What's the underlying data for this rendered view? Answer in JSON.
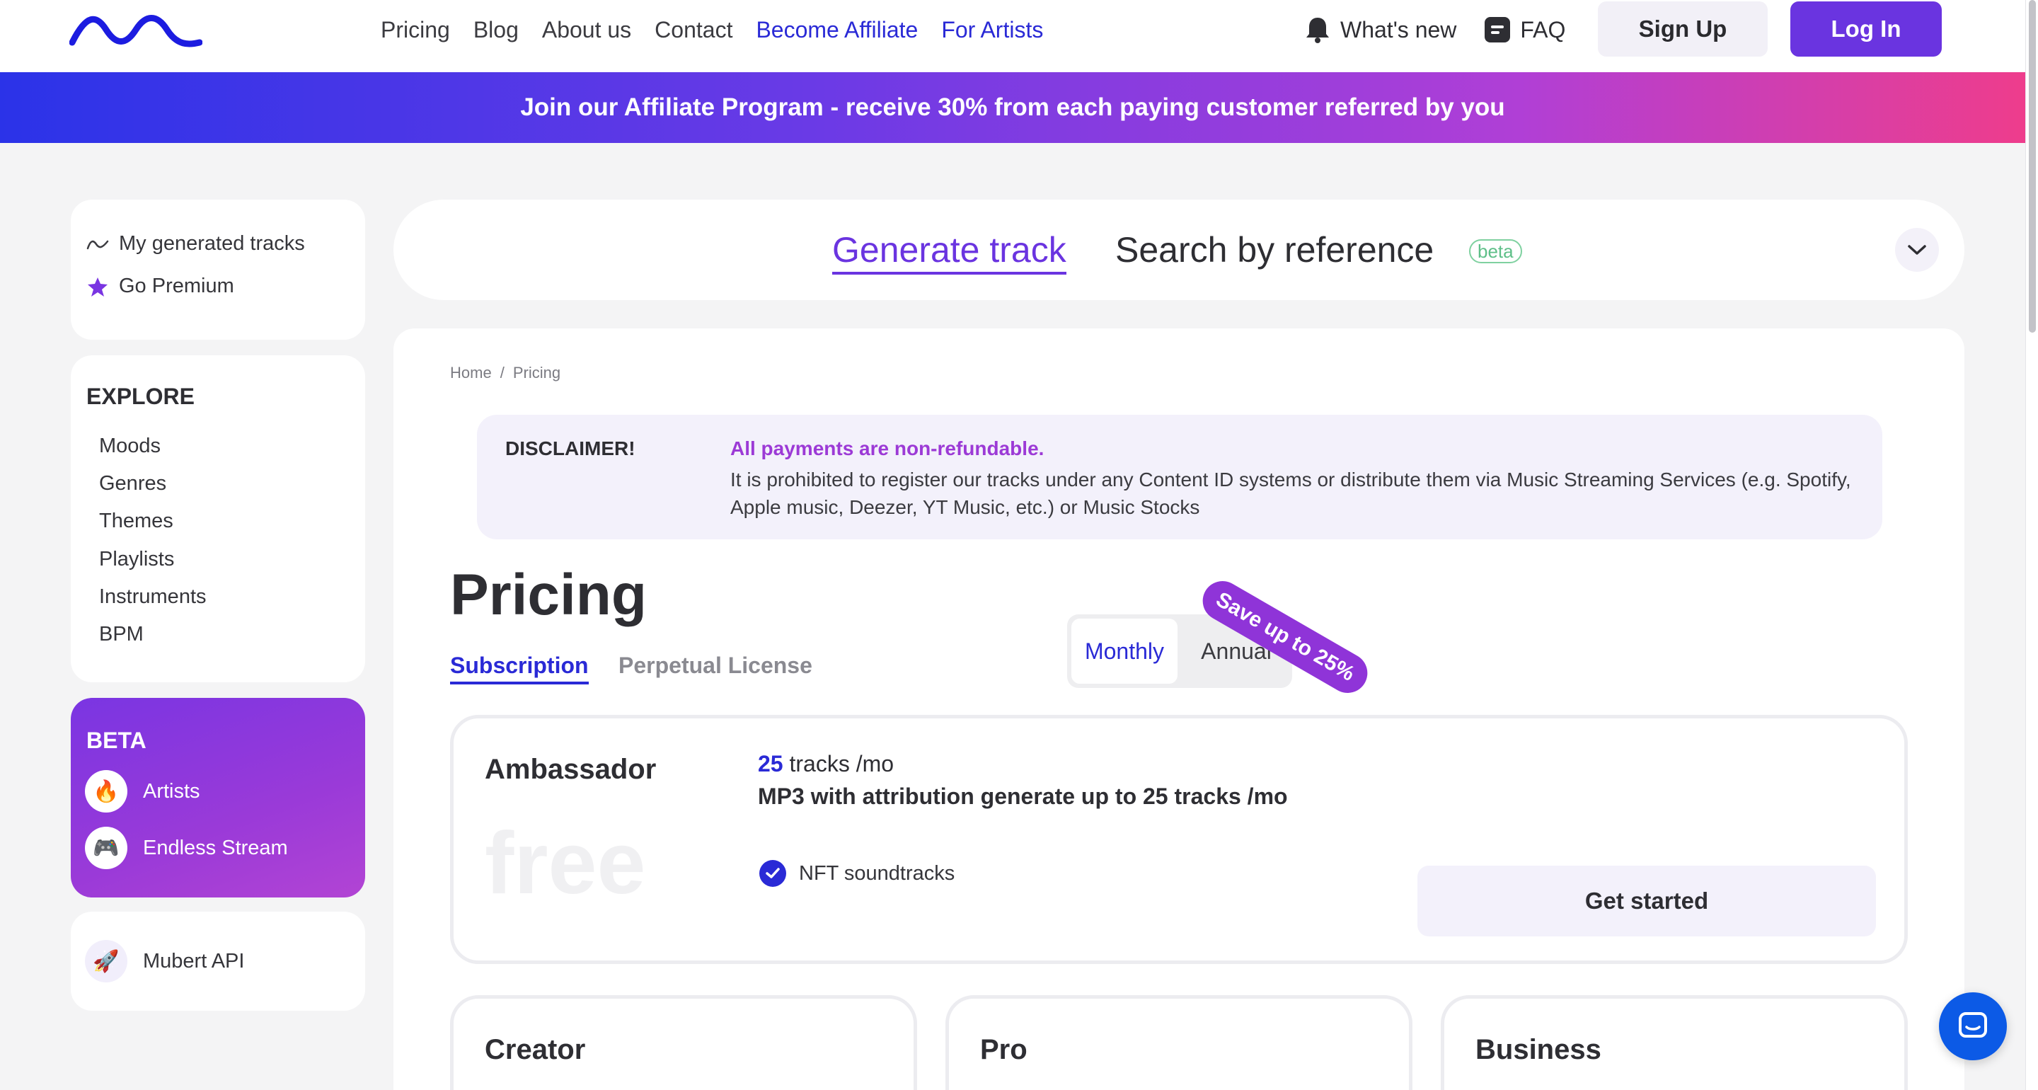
{
  "header": {
    "logo_icon": "wave-logo-icon",
    "nav": [
      {
        "label": "Pricing",
        "accent": false
      },
      {
        "label": "Blog",
        "accent": false
      },
      {
        "label": "About us",
        "accent": false
      },
      {
        "label": "Contact",
        "accent": false
      },
      {
        "label": "Become Affiliate",
        "accent": true
      },
      {
        "label": "For Artists",
        "accent": true
      }
    ],
    "whats_new": "What's new",
    "faq": "FAQ",
    "signup": "Sign Up",
    "login": "Log In"
  },
  "banner": {
    "text": "Join our Affiliate Program - receive 30% from each paying customer referred by you"
  },
  "sidebar": {
    "top_links": [
      {
        "label": "My generated tracks",
        "icon": "wave-icon"
      },
      {
        "label": "Go Premium",
        "icon": "star-icon"
      }
    ],
    "explore_title": "EXPLORE",
    "explore_items": [
      "Moods",
      "Genres",
      "Themes",
      "Playlists",
      "Instruments",
      "BPM"
    ],
    "beta_title": "BETA",
    "beta_items": [
      {
        "label": "Artists",
        "icon": "🔥"
      },
      {
        "label": "Endless Stream",
        "icon": "🎮"
      }
    ],
    "api": {
      "label": "Mubert API",
      "icon": "🚀"
    }
  },
  "tabs": {
    "generate": "Generate track",
    "search": "Search by reference",
    "beta": "beta"
  },
  "breadcrumb": {
    "home": "Home",
    "sep": "/",
    "current": "Pricing"
  },
  "disclaimer": {
    "label": "DISCLAIMER!",
    "strong": "All payments are non-refundable.",
    "text": "It is prohibited to register our tracks under any Content ID systems or distribute them via Music Streaming Services (e.g. Spotify, Apple music, Deezer, YT Music, etc.) or Music Stocks"
  },
  "pricing": {
    "title": "Pricing",
    "tab_subscription": "Subscription",
    "tab_perpetual": "Perpetual License",
    "toggle_monthly": "Monthly",
    "toggle_annual": "Annual",
    "save_badge": "Save up to 25%"
  },
  "plan": {
    "name": "Ambassador",
    "price": "free",
    "tracks_num": "25",
    "tracks_suffix": "tracks /mo",
    "desc": "MP3 with attribution generate up to 25 tracks /mo",
    "feature": "NFT soundtracks",
    "cta": "Get started"
  },
  "plans_more": [
    "Creator",
    "Pro",
    "Business"
  ],
  "colors": {
    "accent_blue": "#2a2ad6",
    "accent_purple": "#6a34e0",
    "disclaimer_purple": "#9c3ad6"
  }
}
